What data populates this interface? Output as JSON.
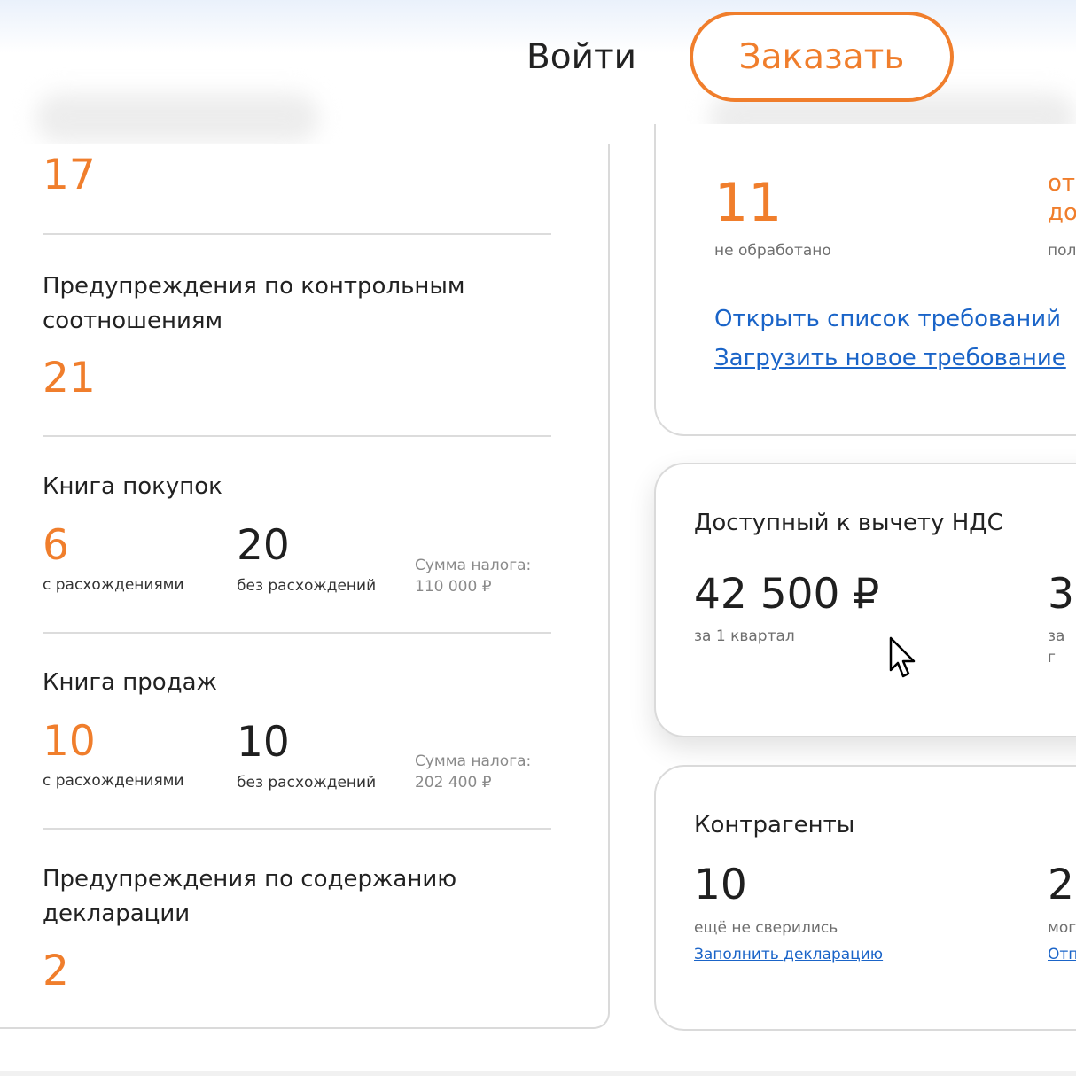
{
  "header": {
    "login_label": "Войти",
    "order_label": "Заказать"
  },
  "left_panel": {
    "top_count": "17",
    "control_ratio": {
      "title": "Предупреждения по контрольным соотношениям",
      "count": "21"
    },
    "purchase_book": {
      "title": "Книга покупок",
      "with_diff_count": "6",
      "with_diff_label": "с расхождениями",
      "no_diff_count": "20",
      "no_diff_label": "без расхождений",
      "tax_label": "Сумма налога:",
      "tax_value": "110 000 ₽"
    },
    "sales_book": {
      "title": "Книга продаж",
      "with_diff_count": "10",
      "with_diff_label": "с расхождениями",
      "no_diff_count": "10",
      "no_diff_label": "без расхождений",
      "tax_label": "Сумма налога:",
      "tax_value": "202 400 ₽"
    },
    "declaration_content": {
      "title": "Предупреждения по содержанию декларации",
      "count": "2"
    }
  },
  "right_panel": {
    "requests": {
      "count": "11",
      "count_label": "не обработано",
      "side_text_1": "от",
      "side_text_2": "до",
      "side_label": "пол",
      "open_list_link": "Открыть список требований",
      "upload_link": "Загрузить новое требование"
    },
    "vat": {
      "title": "Доступный к вычету НДС",
      "amount": "42 500 ₽",
      "period": "за 1 квартал",
      "amount_2": "3",
      "period_2": "за г"
    },
    "counterparties": {
      "title": "Контрагенты",
      "count": "10",
      "count_label": "ещё не сверились",
      "fill_link": "Заполнить декларацию",
      "count_2": "2",
      "count_2_label": "мог",
      "link_2": "Отп"
    }
  },
  "colors": {
    "accent": "#f07e2c",
    "link": "#1a64c8"
  }
}
